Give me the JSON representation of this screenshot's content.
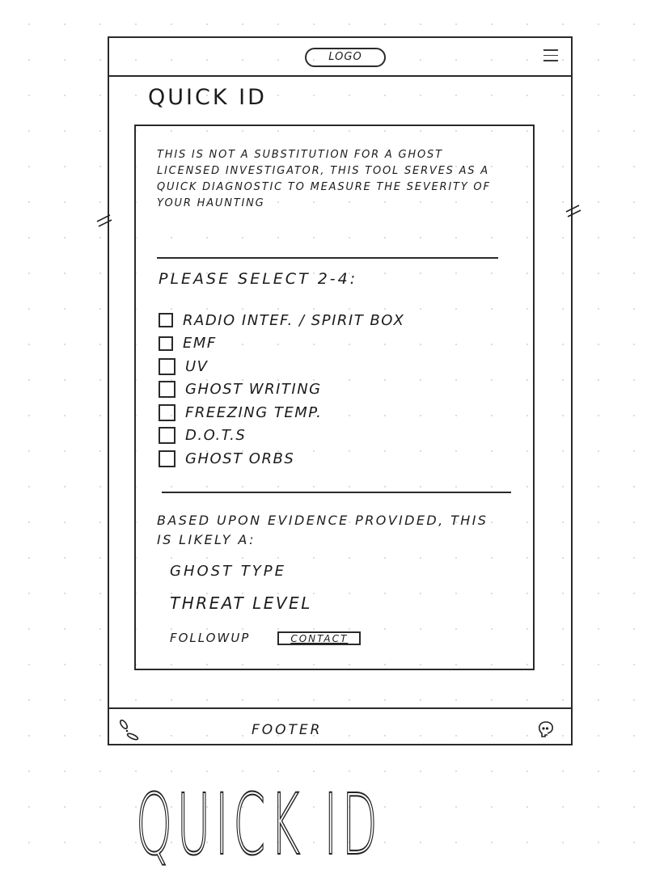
{
  "header": {
    "logo": "LOGO",
    "menu_icon": "hamburger-menu-icon"
  },
  "page": {
    "title": "QUICK ID"
  },
  "card": {
    "intro": "THIS IS NOT A SUBSTITUTION FOR A GHOST LICENSED INVESTIGATOR, THIS TOOL SERVES AS A QUICK DIAGNOSTIC TO MEASURE THE SEVERITY OF YOUR HAUNTING",
    "select_label": "PLEASE SELECT 2-4:",
    "evidence_options": [
      {
        "label": "RADIO INTEF. / SPIRIT BOX",
        "checked": false
      },
      {
        "label": "EMF",
        "checked": false
      },
      {
        "label": "UV",
        "checked": false
      },
      {
        "label": "GHOST WRITING",
        "checked": false
      },
      {
        "label": "FREEZING TEMP.",
        "checked": false
      },
      {
        "label": "D.O.T.S",
        "checked": false
      },
      {
        "label": "GHOST ORBS",
        "checked": false
      }
    ],
    "result_intro": "BASED UPON EVIDENCE PROVIDED, THIS IS LIKELY A:",
    "ghost_type_label": "GHOST TYPE",
    "threat_level_label": "THREAT LEVEL",
    "followup_label": "FOLLOWUP",
    "contact_button": "CONTACT"
  },
  "footer": {
    "label": "FOOTER",
    "left_icon": "ghost-footprints-icon",
    "right_icon": "skull-icon"
  },
  "annotation": {
    "big_title": "QUICK ID"
  }
}
